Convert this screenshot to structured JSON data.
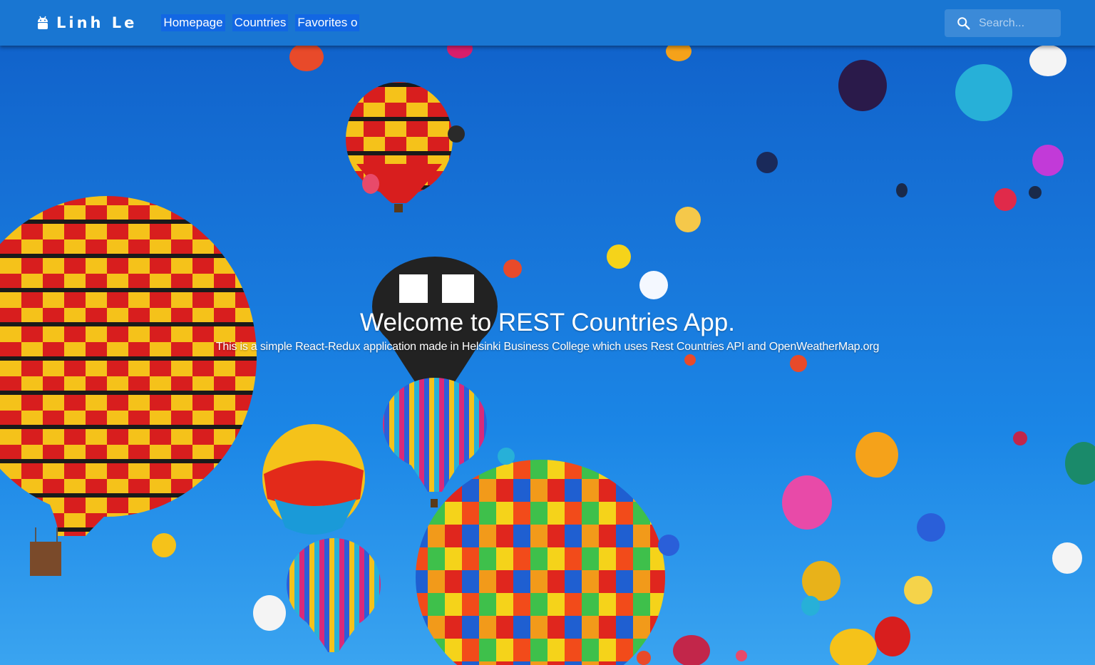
{
  "appbar": {
    "brand": "Linh Le",
    "brand_icon": "android-icon",
    "color": "#1976d2",
    "nav": [
      {
        "label": "Homepage"
      },
      {
        "label": "Countries"
      },
      {
        "label": "Favorites o"
      }
    ],
    "search": {
      "placeholder": "Search...",
      "icon": "search-icon"
    }
  },
  "hero": {
    "title": "Welcome to REST Countries App.",
    "subtitle": "This is a simple React-Redux application made in Helsinki Business College which uses Rest Countries API and OpenWeatherMap.org",
    "background": "hot-air-balloons-photo"
  }
}
